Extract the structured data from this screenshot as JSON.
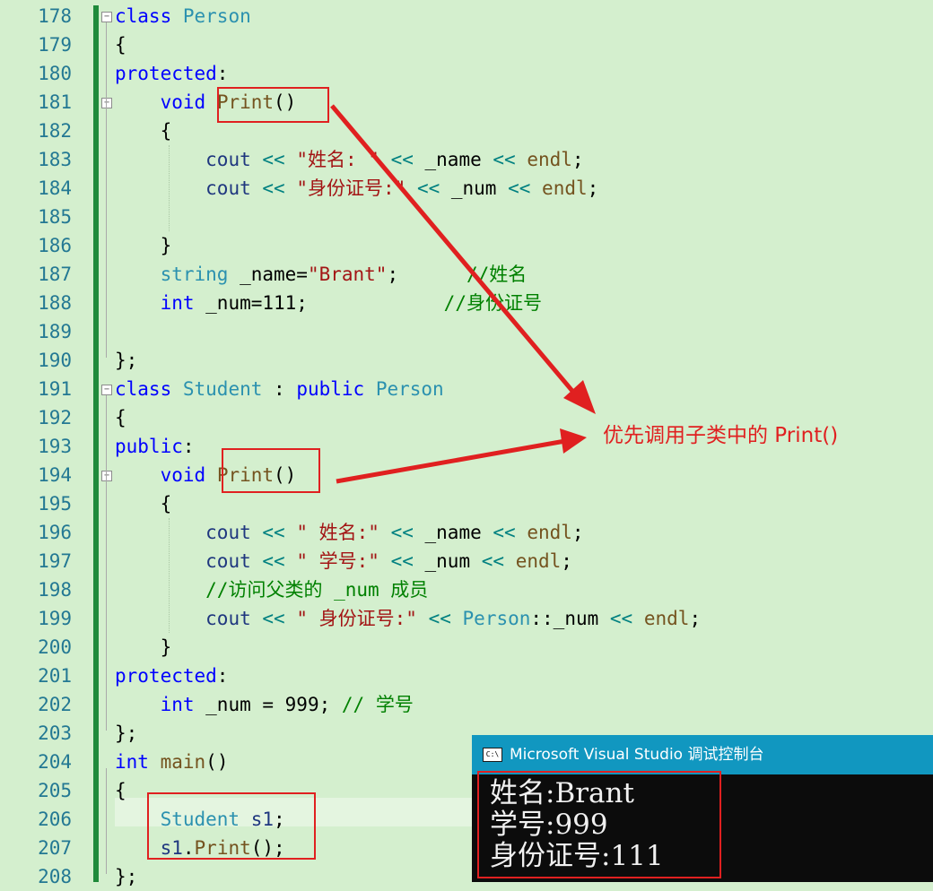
{
  "editor": {
    "line_numbers": [
      "178",
      "179",
      "180",
      "181",
      "182",
      "183",
      "184",
      "185",
      "186",
      "187",
      "188",
      "189",
      "190",
      "191",
      "192",
      "193",
      "194",
      "195",
      "196",
      "197",
      "198",
      "199",
      "200",
      "201",
      "202",
      "203",
      "204",
      "205",
      "206",
      "207",
      "208"
    ],
    "fold_glyph": "−",
    "lines": [
      [
        [
          "kw",
          "class"
        ],
        [
          "t",
          " "
        ],
        [
          "ty",
          "Person"
        ]
      ],
      [
        [
          "t",
          "{"
        ]
      ],
      [
        [
          "kw",
          "protected"
        ],
        [
          "t",
          ":"
        ]
      ],
      [
        [
          "t",
          "    "
        ],
        [
          "kw",
          "void"
        ],
        [
          "t",
          " "
        ],
        [
          "fn",
          "Print"
        ],
        [
          "t",
          "()"
        ]
      ],
      [
        [
          "t",
          "    {"
        ]
      ],
      [
        [
          "t",
          "        "
        ],
        [
          "mo",
          "cout"
        ],
        [
          "t",
          " "
        ],
        [
          "op",
          "<<"
        ],
        [
          "t",
          " "
        ],
        [
          "st",
          "\"姓名: \""
        ],
        [
          "t",
          " "
        ],
        [
          "op",
          "<<"
        ],
        [
          "t",
          " _name "
        ],
        [
          "op",
          "<<"
        ],
        [
          "t",
          " "
        ],
        [
          "fn",
          "endl"
        ],
        [
          "t",
          ";"
        ]
      ],
      [
        [
          "t",
          "        "
        ],
        [
          "mo",
          "cout"
        ],
        [
          "t",
          " "
        ],
        [
          "op",
          "<<"
        ],
        [
          "t",
          " "
        ],
        [
          "st",
          "\"身份证号:\""
        ],
        [
          "t",
          " "
        ],
        [
          "op",
          "<<"
        ],
        [
          "t",
          " _num "
        ],
        [
          "op",
          "<<"
        ],
        [
          "t",
          " "
        ],
        [
          "fn",
          "endl"
        ],
        [
          "t",
          ";"
        ]
      ],
      [
        [
          "t",
          ""
        ]
      ],
      [
        [
          "t",
          "    }"
        ]
      ],
      [
        [
          "t",
          "    "
        ],
        [
          "ty",
          "string"
        ],
        [
          "t",
          " _name="
        ],
        [
          "st",
          "\"Brant\""
        ],
        [
          "t",
          ";      "
        ],
        [
          "cm",
          "//姓名"
        ]
      ],
      [
        [
          "t",
          "    "
        ],
        [
          "kw",
          "int"
        ],
        [
          "t",
          " _num=111;            "
        ],
        [
          "cm",
          "//身份证号"
        ]
      ],
      [
        [
          "t",
          ""
        ]
      ],
      [
        [
          "t",
          "};"
        ]
      ],
      [
        [
          "kw",
          "class"
        ],
        [
          "t",
          " "
        ],
        [
          "ty",
          "Student"
        ],
        [
          "t",
          " : "
        ],
        [
          "kw",
          "public"
        ],
        [
          "t",
          " "
        ],
        [
          "ty",
          "Person"
        ]
      ],
      [
        [
          "t",
          "{"
        ]
      ],
      [
        [
          "kw",
          "public"
        ],
        [
          "t",
          ":"
        ]
      ],
      [
        [
          "t",
          "    "
        ],
        [
          "kw",
          "void"
        ],
        [
          "t",
          " "
        ],
        [
          "fn",
          "Print"
        ],
        [
          "t",
          "()"
        ]
      ],
      [
        [
          "t",
          "    {"
        ]
      ],
      [
        [
          "t",
          "        "
        ],
        [
          "mo",
          "cout"
        ],
        [
          "t",
          " "
        ],
        [
          "op",
          "<<"
        ],
        [
          "t",
          " "
        ],
        [
          "st",
          "\" 姓名:\""
        ],
        [
          "t",
          " "
        ],
        [
          "op",
          "<<"
        ],
        [
          "t",
          " _name "
        ],
        [
          "op",
          "<<"
        ],
        [
          "t",
          " "
        ],
        [
          "fn",
          "endl"
        ],
        [
          "t",
          ";"
        ]
      ],
      [
        [
          "t",
          "        "
        ],
        [
          "mo",
          "cout"
        ],
        [
          "t",
          " "
        ],
        [
          "op",
          "<<"
        ],
        [
          "t",
          " "
        ],
        [
          "st",
          "\" 学号:\""
        ],
        [
          "t",
          " "
        ],
        [
          "op",
          "<<"
        ],
        [
          "t",
          " _num "
        ],
        [
          "op",
          "<<"
        ],
        [
          "t",
          " "
        ],
        [
          "fn",
          "endl"
        ],
        [
          "t",
          ";"
        ]
      ],
      [
        [
          "t",
          "        "
        ],
        [
          "cm",
          "//访问父类的 _num 成员"
        ]
      ],
      [
        [
          "t",
          "        "
        ],
        [
          "mo",
          "cout"
        ],
        [
          "t",
          " "
        ],
        [
          "op",
          "<<"
        ],
        [
          "t",
          " "
        ],
        [
          "st",
          "\" 身份证号:\""
        ],
        [
          "t",
          " "
        ],
        [
          "op",
          "<<"
        ],
        [
          "t",
          " "
        ],
        [
          "ty",
          "Person"
        ],
        [
          "t",
          "::_num "
        ],
        [
          "op",
          "<<"
        ],
        [
          "t",
          " "
        ],
        [
          "fn",
          "endl"
        ],
        [
          "t",
          ";"
        ]
      ],
      [
        [
          "t",
          "    }"
        ]
      ],
      [
        [
          "kw",
          "protected"
        ],
        [
          "t",
          ":"
        ]
      ],
      [
        [
          "t",
          "    "
        ],
        [
          "kw",
          "int"
        ],
        [
          "t",
          " _num = 999; "
        ],
        [
          "cm",
          "// 学号"
        ]
      ],
      [
        [
          "t",
          "};"
        ]
      ],
      [
        [
          "kw",
          "int"
        ],
        [
          "t",
          " "
        ],
        [
          "fn",
          "main"
        ],
        [
          "t",
          "()"
        ]
      ],
      [
        [
          "t",
          "{"
        ]
      ],
      [
        [
          "t",
          "    "
        ],
        [
          "ty",
          "Student"
        ],
        [
          "t",
          " "
        ],
        [
          "mo",
          "s1"
        ],
        [
          "t",
          ";"
        ]
      ],
      [
        [
          "t",
          "    "
        ],
        [
          "mo",
          "s1"
        ],
        [
          "t",
          "."
        ],
        [
          "fn",
          "Print"
        ],
        [
          "t",
          "();"
        ]
      ],
      [
        [
          "t",
          "};"
        ]
      ]
    ]
  },
  "annotation": {
    "text": "优先调用子类中的 Print()",
    "color": "#e02020"
  },
  "console": {
    "icon_label": "C:\\",
    "title": "Microsoft Visual Studio 调试控制台",
    "output": [
      "姓名:Brant",
      "学号:999",
      "身份证号:111"
    ]
  },
  "colors": {
    "keyword": "#0000ff",
    "type": "#2b91af",
    "function": "#74531f",
    "string": "#a31515",
    "comment": "#008000",
    "highlight": "#e02020",
    "background": "#d4efce",
    "console_title_bar": "#1197c0"
  }
}
